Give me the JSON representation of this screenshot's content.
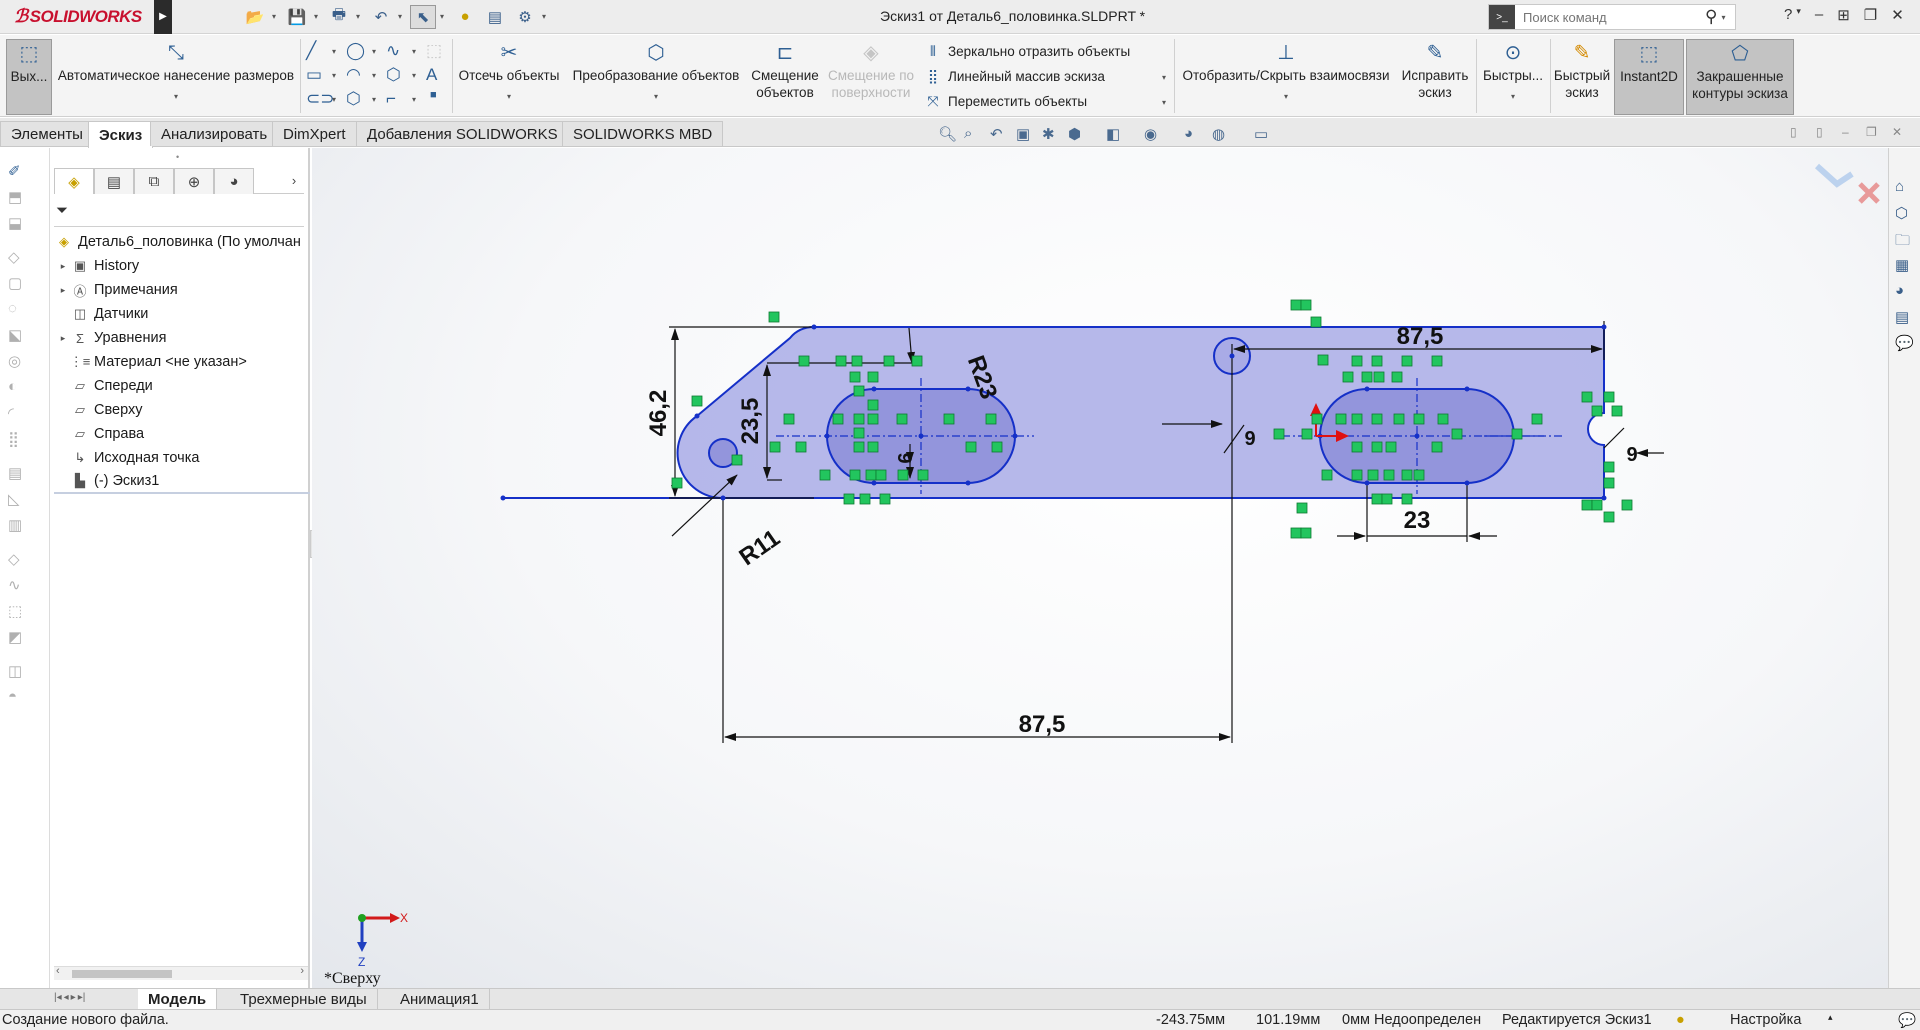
{
  "app": {
    "logo_text": "SOLIDWORKS",
    "document_title": "Эскиз1 от Деталь6_половинка.SLDPRT *",
    "search_placeholder": "Поиск команд",
    "help": "?"
  },
  "ribbon": {
    "exit_sketch": "Вых...",
    "smart_dimension": "Автоматическое нанесение размеров",
    "trim": "Отсечь объекты",
    "convert": "Преобразование объектов",
    "offset_line1": "Смещение",
    "offset_line2": "объектов",
    "offset_surface_line1": "Смещение по",
    "offset_surface_line2": "поверхности",
    "mirror": "Зеркально отразить объекты",
    "linear_pattern": "Линейный массив эскиза",
    "move": "Переместить объекты",
    "display_relations": "Отобразить/Скрыть взаимосвязи",
    "repair_line1": "Исправить",
    "repair_line2": "эскиз",
    "quick_snaps": "Быстры...",
    "rapid_sketch_line1": "Быстрый",
    "rapid_sketch_line2": "эскиз",
    "instant2d": "Instant2D",
    "shaded_line1": "Закрашенные",
    "shaded_line2": "контуры эскиза"
  },
  "tabs": [
    {
      "label": "Элементы",
      "active": false
    },
    {
      "label": "Эскиз",
      "active": true
    },
    {
      "label": "Анализировать",
      "active": false
    },
    {
      "label": "DimXpert",
      "active": false
    },
    {
      "label": "Добавления SOLIDWORKS",
      "active": false
    },
    {
      "label": "SOLIDWORKS MBD",
      "active": false
    }
  ],
  "tree": {
    "root": "Деталь6_половинка  (По умолчан",
    "items": [
      {
        "label": "History",
        "expandable": true,
        "icon": "history-icon"
      },
      {
        "label": "Примечания",
        "expandable": true,
        "icon": "annotations-icon"
      },
      {
        "label": "Датчики",
        "expandable": false,
        "icon": "sensors-icon"
      },
      {
        "label": "Уравнения",
        "expandable": true,
        "icon": "equations-icon"
      },
      {
        "label": "Материал <не указан>",
        "expandable": false,
        "icon": "material-icon"
      },
      {
        "label": "Спереди",
        "expandable": false,
        "icon": "plane-icon"
      },
      {
        "label": "Сверху",
        "expandable": false,
        "icon": "plane-icon"
      },
      {
        "label": "Справа",
        "expandable": false,
        "icon": "plane-icon"
      },
      {
        "label": "Исходная точка",
        "expandable": false,
        "icon": "origin-icon"
      },
      {
        "label": "(-) Эскиз1",
        "expandable": false,
        "icon": "sketch-icon"
      }
    ]
  },
  "sketch": {
    "dims": {
      "top_width": "87,5",
      "bottom_width": "87,5",
      "height": "46,2",
      "inner_height": "23,5",
      "slot_radius": "R23",
      "end_radius": "R11",
      "slot_length": "23",
      "hole_dia_left": "9",
      "hole_dia_mid": "9",
      "hole_dia_right": "9"
    },
    "view_label": "*Сверху",
    "triad_x": "X",
    "triad_z": "Z"
  },
  "model_tabs": [
    {
      "label": "Модель",
      "active": true
    },
    {
      "label": "Трехмерные виды",
      "active": false
    },
    {
      "label": "Анимация1",
      "active": false
    }
  ],
  "status": {
    "message": "Создание нового файла.",
    "x": "-243.75мм",
    "y": "101.19мм",
    "z_state": "0мм Недоопределен",
    "editing": "Редактируется Эскиз1",
    "units": "Настройка"
  },
  "colors": {
    "sketch_fill": "#a9abe6",
    "sketch_line": "#1530c8",
    "relation_icon": "#22c55e",
    "dim_line": "#111111",
    "brand": "#c8102e"
  }
}
